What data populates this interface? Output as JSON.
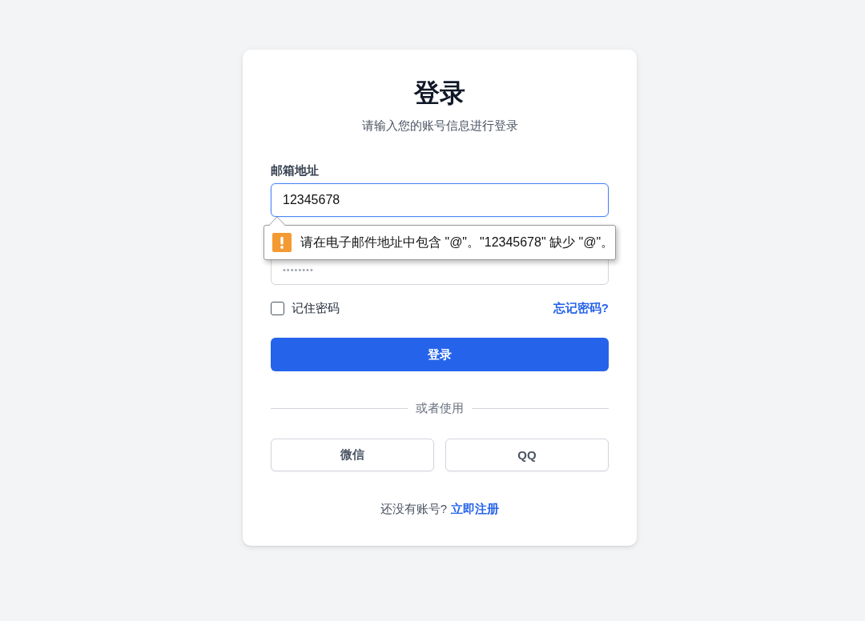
{
  "header": {
    "title": "登录",
    "subtitle": "请输入您的账号信息进行登录"
  },
  "email": {
    "label": "邮箱地址",
    "value": "12345678",
    "focused": true
  },
  "validation_tooltip": {
    "message": "请在电子邮件地址中包含 \"@\"。\"12345678\" 缺少 \"@\"。"
  },
  "password": {
    "placeholder": "••••••••"
  },
  "remember_me": {
    "label": "记住密码",
    "checked": false
  },
  "forgot_link": "忘记密码?",
  "submit_button": "登录",
  "divider": "或者使用",
  "social_buttons": [
    "微信",
    "QQ"
  ],
  "footer": {
    "text": "还没有账号?",
    "link": "立即注册"
  }
}
